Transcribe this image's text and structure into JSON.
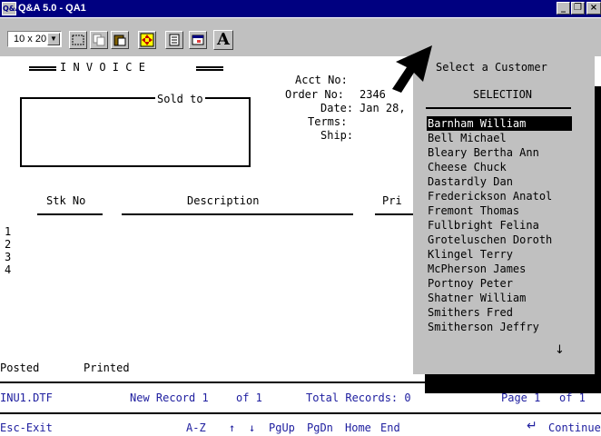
{
  "window": {
    "app_icon_text": "Q&A",
    "title": "Q&A 5.0 - QA1",
    "min_glyph": "_",
    "max_glyph": "❐",
    "close_glyph": "×"
  },
  "toolbar": {
    "font_size": "10 x 20",
    "text_button": "A"
  },
  "invoice": {
    "heading": "I N V O I C E",
    "sold_to": "Sold to",
    "acct_no_label": "Acct No:",
    "acct_no": "",
    "order_no_label": "Order No:",
    "order_no": "2346",
    "date_label": "Date:",
    "date": "Jan 28,",
    "terms_label": "Terms:",
    "ship_label": "Ship:",
    "col_stk": "Stk No",
    "col_desc": "Description",
    "col_price": "Pri",
    "line_numbers": [
      "1",
      "2",
      "3",
      "4"
    ],
    "posted": "Posted",
    "printed": "Printed"
  },
  "popup": {
    "title": "Select a Customer",
    "subtitle": "SELECTION",
    "customers": [
      "Barnham William",
      "Bell Michael",
      "Bleary Bertha Ann",
      "Cheese Chuck",
      "Dastardly Dan",
      "Frederickson Anatol",
      "Fremont Thomas",
      "Fullbright Felina",
      "Groteluschen Doroth",
      "Klingel Terry",
      "McPherson James",
      "Portnoy Peter",
      "Shatner William",
      "Smithers Fred",
      "Smitherson Jeffry"
    ],
    "selected_index": 0,
    "scroll_glyph": "↓"
  },
  "status": {
    "file": "INU1.DTF",
    "record": "New Record 1",
    "of": "of 1",
    "total": "Total Records: 0",
    "page": "Page 1",
    "page_of": "of 1"
  },
  "keys": {
    "esc": "Esc-Exit",
    "az": "A-Z",
    "up": "↑",
    "down": "↓",
    "pgup": "PgUp",
    "pgdn": "PgDn",
    "home": "Home",
    "end": "End",
    "enter_glyph": "↵",
    "continue": "Continue"
  }
}
